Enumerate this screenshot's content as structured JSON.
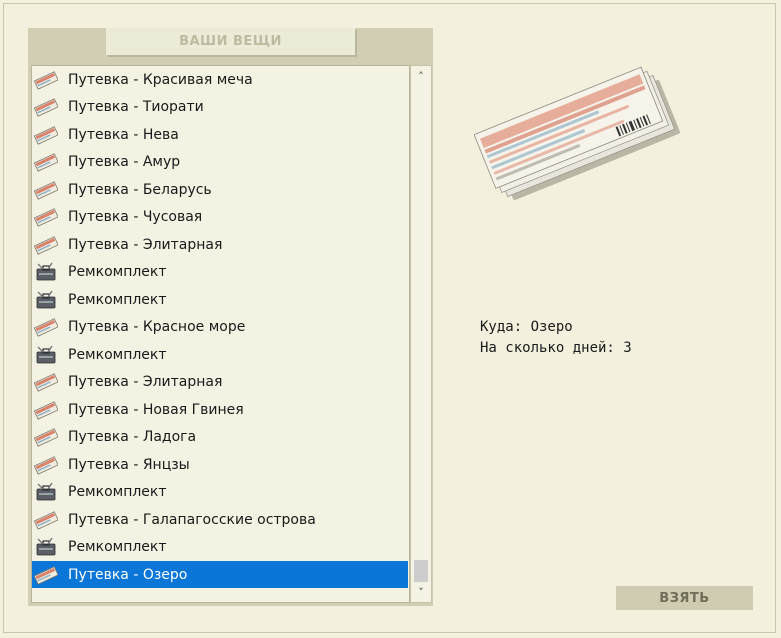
{
  "panel": {
    "title": "ВАШИ ВЕЩИ"
  },
  "items": [
    {
      "label": "Путевка - Красивая меча",
      "icon": "ticket-icon"
    },
    {
      "label": "Путевка - Тиорати",
      "icon": "ticket-icon"
    },
    {
      "label": "Путевка - Нева",
      "icon": "ticket-icon"
    },
    {
      "label": "Путевка - Амур",
      "icon": "ticket-icon"
    },
    {
      "label": "Путевка - Беларусь",
      "icon": "ticket-icon"
    },
    {
      "label": "Путевка - Чусовая",
      "icon": "ticket-icon"
    },
    {
      "label": "Путевка - Элитарная",
      "icon": "ticket-icon"
    },
    {
      "label": "Ремкомплект",
      "icon": "repair-kit-icon"
    },
    {
      "label": "Ремкомплект",
      "icon": "repair-kit-icon"
    },
    {
      "label": "Путевка - Красное море",
      "icon": "ticket-icon"
    },
    {
      "label": "Ремкомплект",
      "icon": "repair-kit-icon"
    },
    {
      "label": "Путевка - Элитарная",
      "icon": "ticket-icon"
    },
    {
      "label": "Путевка - Новая Гвинея",
      "icon": "ticket-icon"
    },
    {
      "label": "Путевка - Ладога",
      "icon": "ticket-icon"
    },
    {
      "label": "Путевка - Янцзы",
      "icon": "ticket-icon"
    },
    {
      "label": "Ремкомплект",
      "icon": "repair-kit-icon"
    },
    {
      "label": "Путевка - Галапагосские острова",
      "icon": "ticket-icon"
    },
    {
      "label": "Ремкомплект",
      "icon": "repair-kit-icon"
    },
    {
      "label": "Путевка - Озеро",
      "icon": "ticket-icon",
      "selected": true
    }
  ],
  "details": {
    "line1": "Куда: Озеро",
    "line2": "На сколько дней: 3",
    "image": "ticket-booklet-image"
  },
  "actions": {
    "take_label": "ВЗЯТЬ"
  },
  "colors": {
    "selection": "#0a76d8",
    "panel_bg": "#d1ceb4",
    "page_bg": "#f3f1de"
  }
}
